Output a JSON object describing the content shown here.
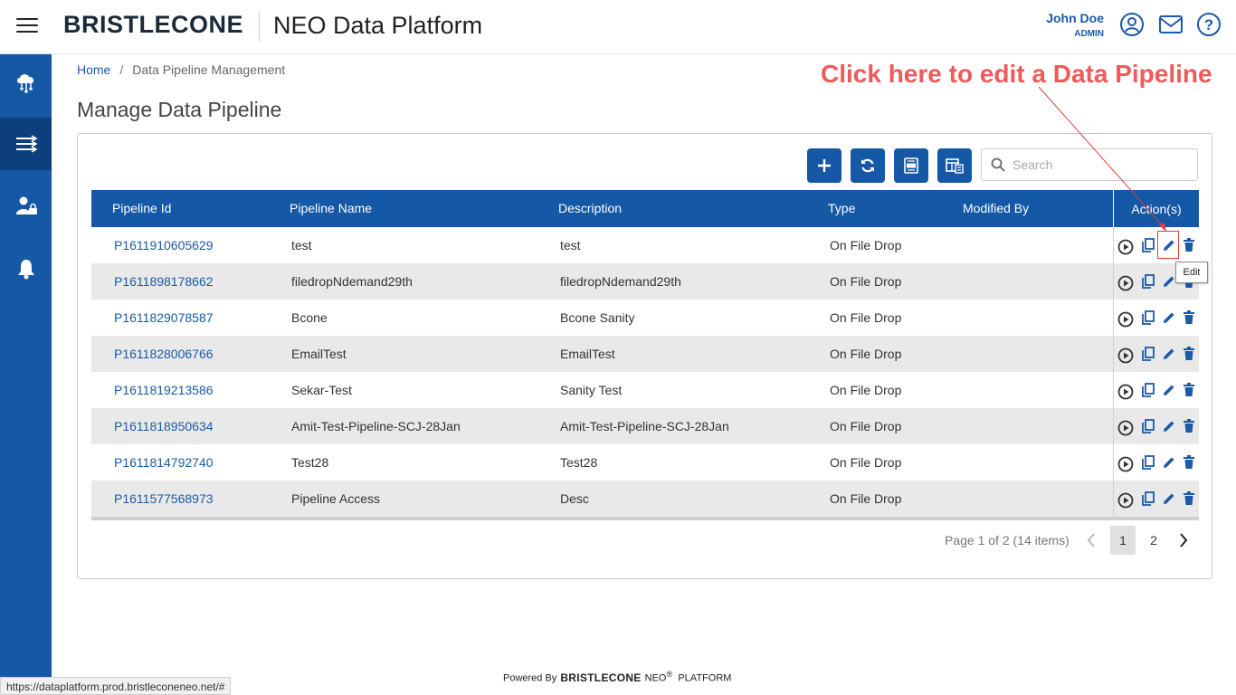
{
  "header": {
    "brand": "BRISTLECONE",
    "app_title": "NEO Data Platform",
    "user_name": "John Doe",
    "user_role": "ADMIN"
  },
  "sidebar": {
    "items": [
      {
        "name": "cloud-network-icon",
        "active": false
      },
      {
        "name": "pipeline-icon",
        "active": true
      },
      {
        "name": "user-admin-icon",
        "active": false
      },
      {
        "name": "bell-icon",
        "active": false
      }
    ]
  },
  "breadcrumb": {
    "home": "Home",
    "separator": "/",
    "current": "Data Pipeline Management"
  },
  "page_title": "Manage Data Pipeline",
  "annotation": "Click here to edit a Data Pipeline",
  "search": {
    "placeholder": "Search",
    "value": ""
  },
  "table": {
    "headers": {
      "id": "Pipeline Id",
      "name": "Pipeline Name",
      "description": "Description",
      "type": "Type",
      "modified_by": "Modified By",
      "actions": "Action(s)"
    },
    "rows": [
      {
        "id": "P1611910605629",
        "name": "test",
        "description": "test",
        "type": "On File Drop",
        "modified_by": ""
      },
      {
        "id": "P1611898178662",
        "name": "filedropNdemand29th",
        "description": "filedropNdemand29th",
        "type": "On File Drop",
        "modified_by": ""
      },
      {
        "id": "P1611829078587",
        "name": "Bcone",
        "description": "Bcone Sanity",
        "type": "On File Drop",
        "modified_by": ""
      },
      {
        "id": "P1611828006766",
        "name": "EmailTest",
        "description": "EmailTest",
        "type": "On File Drop",
        "modified_by": ""
      },
      {
        "id": "P1611819213586",
        "name": "Sekar-Test",
        "description": "Sanity Test",
        "type": "On File Drop",
        "modified_by": ""
      },
      {
        "id": "P1611818950634",
        "name": "Amit-Test-Pipeline-SCJ-28Jan",
        "description": "Amit-Test-Pipeline-SCJ-28Jan",
        "type": "On File Drop",
        "modified_by": ""
      },
      {
        "id": "P1611814792740",
        "name": "Test28",
        "description": "Test28",
        "type": "On File Drop",
        "modified_by": ""
      },
      {
        "id": "P1611577568973",
        "name": "Pipeline Access",
        "description": "Desc",
        "type": "On File Drop",
        "modified_by": ""
      }
    ]
  },
  "tooltip": "Edit",
  "pagination": {
    "info": "Page 1 of 2 (14 items)",
    "pages": [
      "1",
      "2"
    ],
    "current": "1"
  },
  "footer": {
    "powered_by": "Powered By",
    "brand": "BRISTLECONE",
    "product": "NEO",
    "registered": "®",
    "platform": "PLATFORM"
  },
  "status_url": "https://dataplatform.prod.bristleconeneo.net/#",
  "colors": {
    "primary": "#1458a6",
    "sidebar_active": "#0d3f7c",
    "link": "#1a5aa8",
    "annotation": "#f05a5a",
    "row_alt": "#e9e9e9"
  }
}
